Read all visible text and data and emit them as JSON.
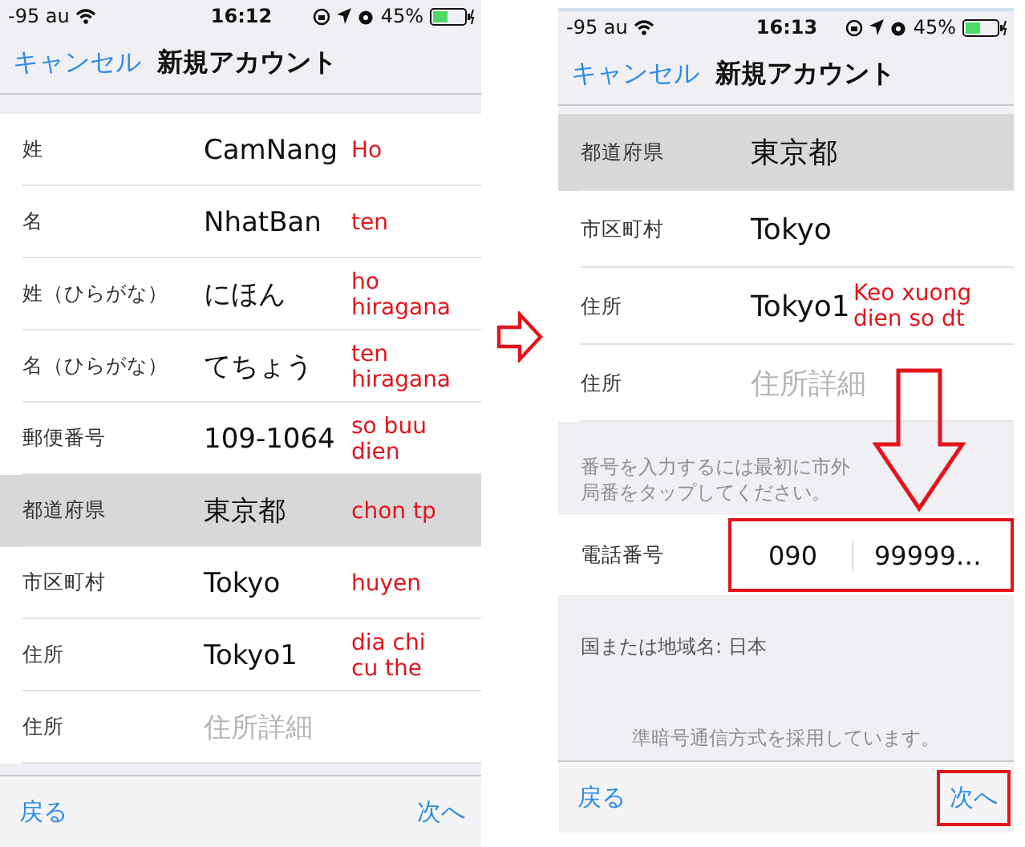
{
  "screens": [
    {
      "status_bar": {
        "carrier": "-95 au",
        "time": "16:12",
        "battery": "45%"
      },
      "nav_bar": {
        "cancel": "キャンセル",
        "title": "新規アカウント"
      },
      "sections": [
        {
          "kind": "rows",
          "rows": [
            {
              "label": "姓",
              "value": "CamNang",
              "selected": false,
              "note": "Ho"
            },
            {
              "label": "名",
              "value": "NhatBan",
              "selected": false,
              "note": "ten"
            },
            {
              "label": "姓（ひらがな）",
              "value": "にほん",
              "selected": false,
              "note": "ho\nhiragana"
            },
            {
              "label": "名（ひらがな）",
              "value": "てちょう",
              "selected": false,
              "note": "ten\nhiragana"
            },
            {
              "label": "郵便番号",
              "value": "109-1064",
              "selected": false,
              "note": "so buu\ndien"
            },
            {
              "label": "都道府県",
              "value": "東京都",
              "selected": true,
              "note": "chon tp"
            },
            {
              "label": "市区町村",
              "value": "Tokyo",
              "selected": false,
              "note": "huyen"
            },
            {
              "label": "住所",
              "value": "Tokyo1",
              "selected": false,
              "note": "dia chi\ncu the"
            },
            {
              "label": "住所",
              "placeholder": "住所詳細",
              "selected": false
            }
          ]
        }
      ],
      "toolbar": {
        "back": "戻る",
        "next": "次へ",
        "next_highlighted": false
      }
    },
    {
      "status_bar": {
        "carrier": "-95 au",
        "time": "16:13",
        "battery": "45%"
      },
      "nav_bar": {
        "cancel": "キャンセル",
        "title": "新規アカウント"
      },
      "sections": [
        {
          "kind": "rows",
          "rows": [
            {
              "label": "都道府県",
              "value": "東京都",
              "selected": true
            },
            {
              "label": "市区町村",
              "value": "Tokyo",
              "selected": false
            },
            {
              "label": "住所",
              "value": "Tokyo1",
              "selected": false,
              "note": "Keo xuong\ndien so dt"
            },
            {
              "label": "住所",
              "placeholder": "住所詳細",
              "selected": false
            }
          ]
        },
        {
          "kind": "hint",
          "text": "番号を入力するには最初に市外局番をタップしてください。"
        },
        {
          "kind": "phone",
          "label": "電話番号",
          "area_code": "090",
          "number": "99999…",
          "highlighted": true
        },
        {
          "kind": "info",
          "text": "国または地域名: 日本"
        },
        {
          "kind": "center_hint",
          "text": "準暗号通信方式を採用しています。"
        }
      ],
      "toolbar": {
        "back": "戻る",
        "next": "次へ",
        "next_highlighted": true
      }
    }
  ]
}
